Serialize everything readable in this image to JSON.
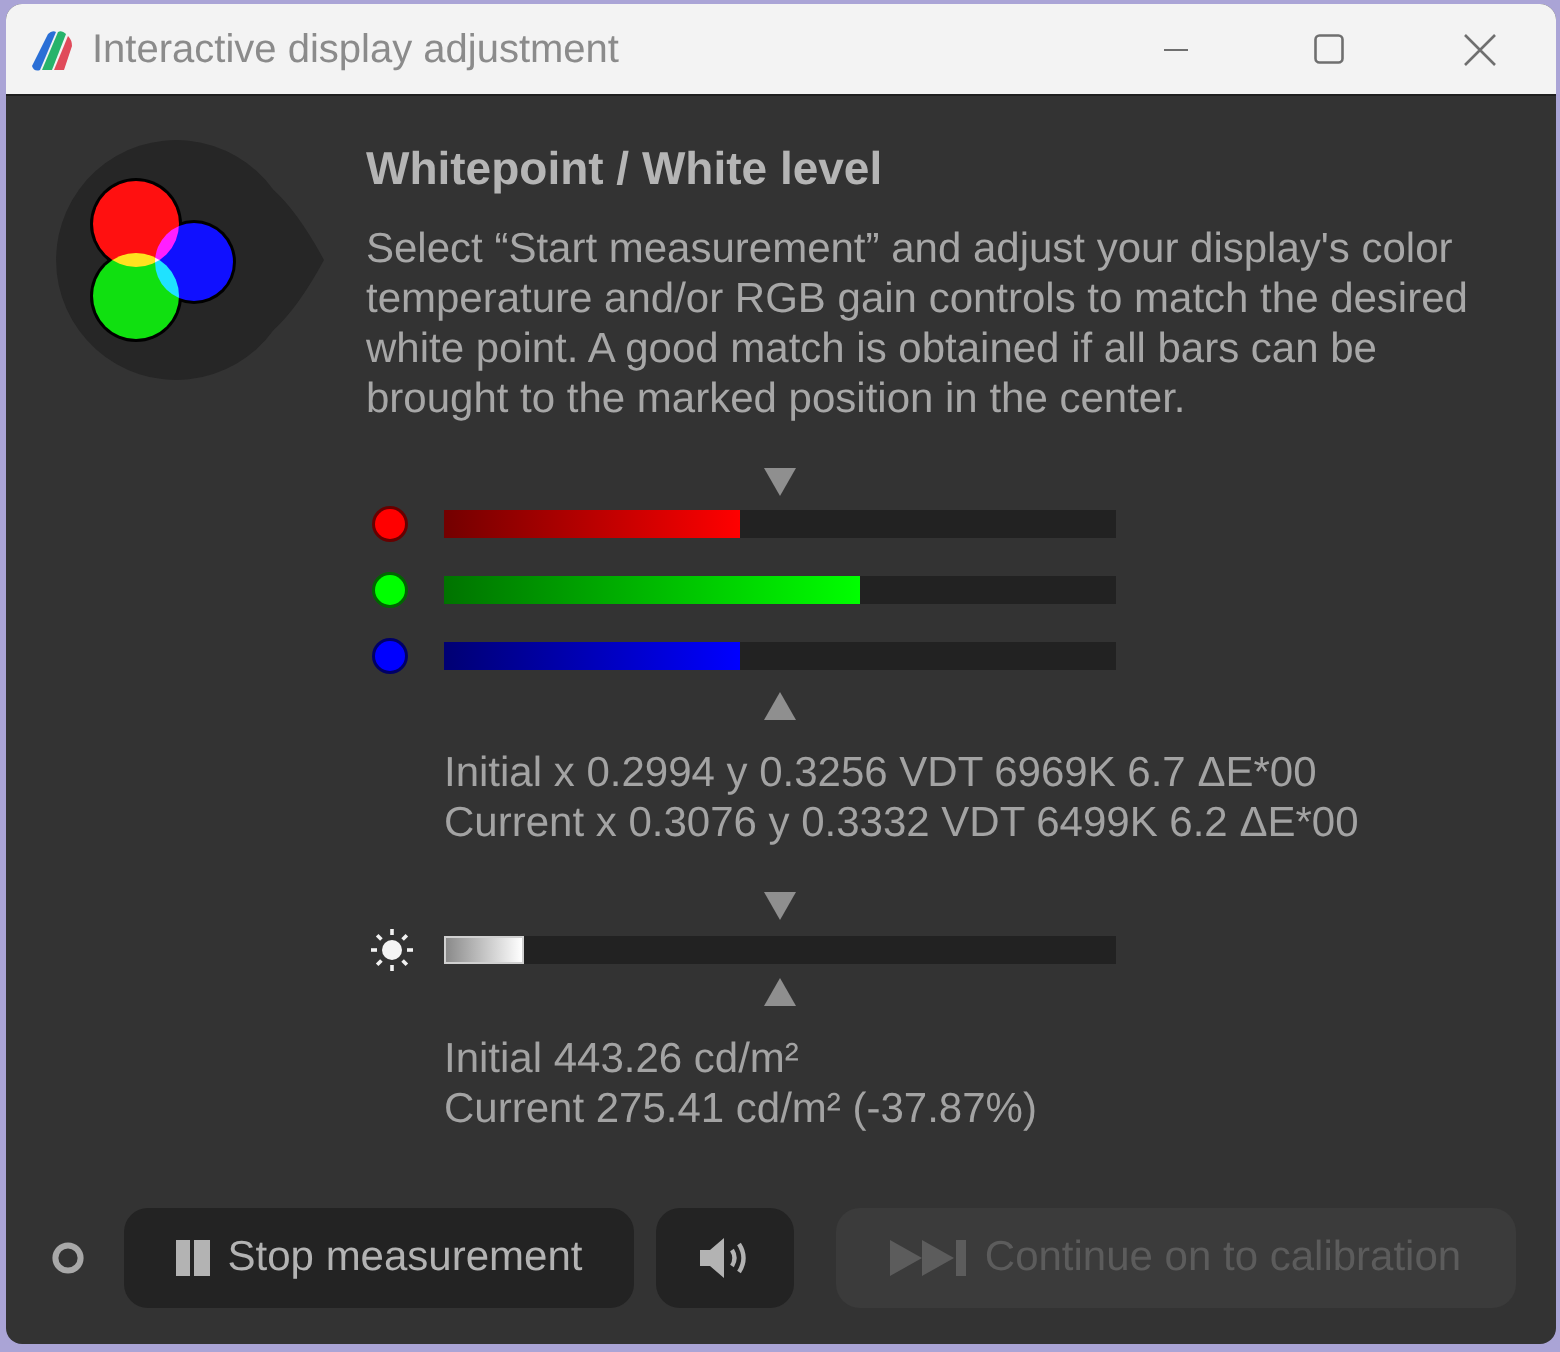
{
  "window": {
    "title": "Interactive display adjustment"
  },
  "header": {
    "title": "Whitepoint / White level",
    "description": "Select “Start measurement” and adjust your display's color temperature and/or RGB gain controls to match the desired white point. A good match is obtained if all bars can be brought to the marked position in the center."
  },
  "channels": [
    {
      "color": "#ff0000",
      "level": 0.44
    },
    {
      "color": "#00ff00",
      "level": 0.62
    },
    {
      "color": "#0000ff",
      "level": 0.44
    }
  ],
  "chromaticity": [
    "Initial x 0.2994 y 0.3256 VDT 6969K 6.7 ΔE*00",
    "Current x 0.3076 y 0.3332 VDT 6499K 6.2 ΔE*00"
  ],
  "luminance": {
    "level": 0.12,
    "readings": [
      "Initial 443.26 cd/m²",
      "Current 275.41 cd/m² (-37.87%)"
    ]
  },
  "buttons": [
    {
      "kind": "stop",
      "label": "Stop measurement",
      "disabled": false
    },
    {
      "kind": "sound",
      "disabled": false
    },
    {
      "kind": "continue",
      "label": "Continue on to calibration",
      "disabled": true
    }
  ]
}
